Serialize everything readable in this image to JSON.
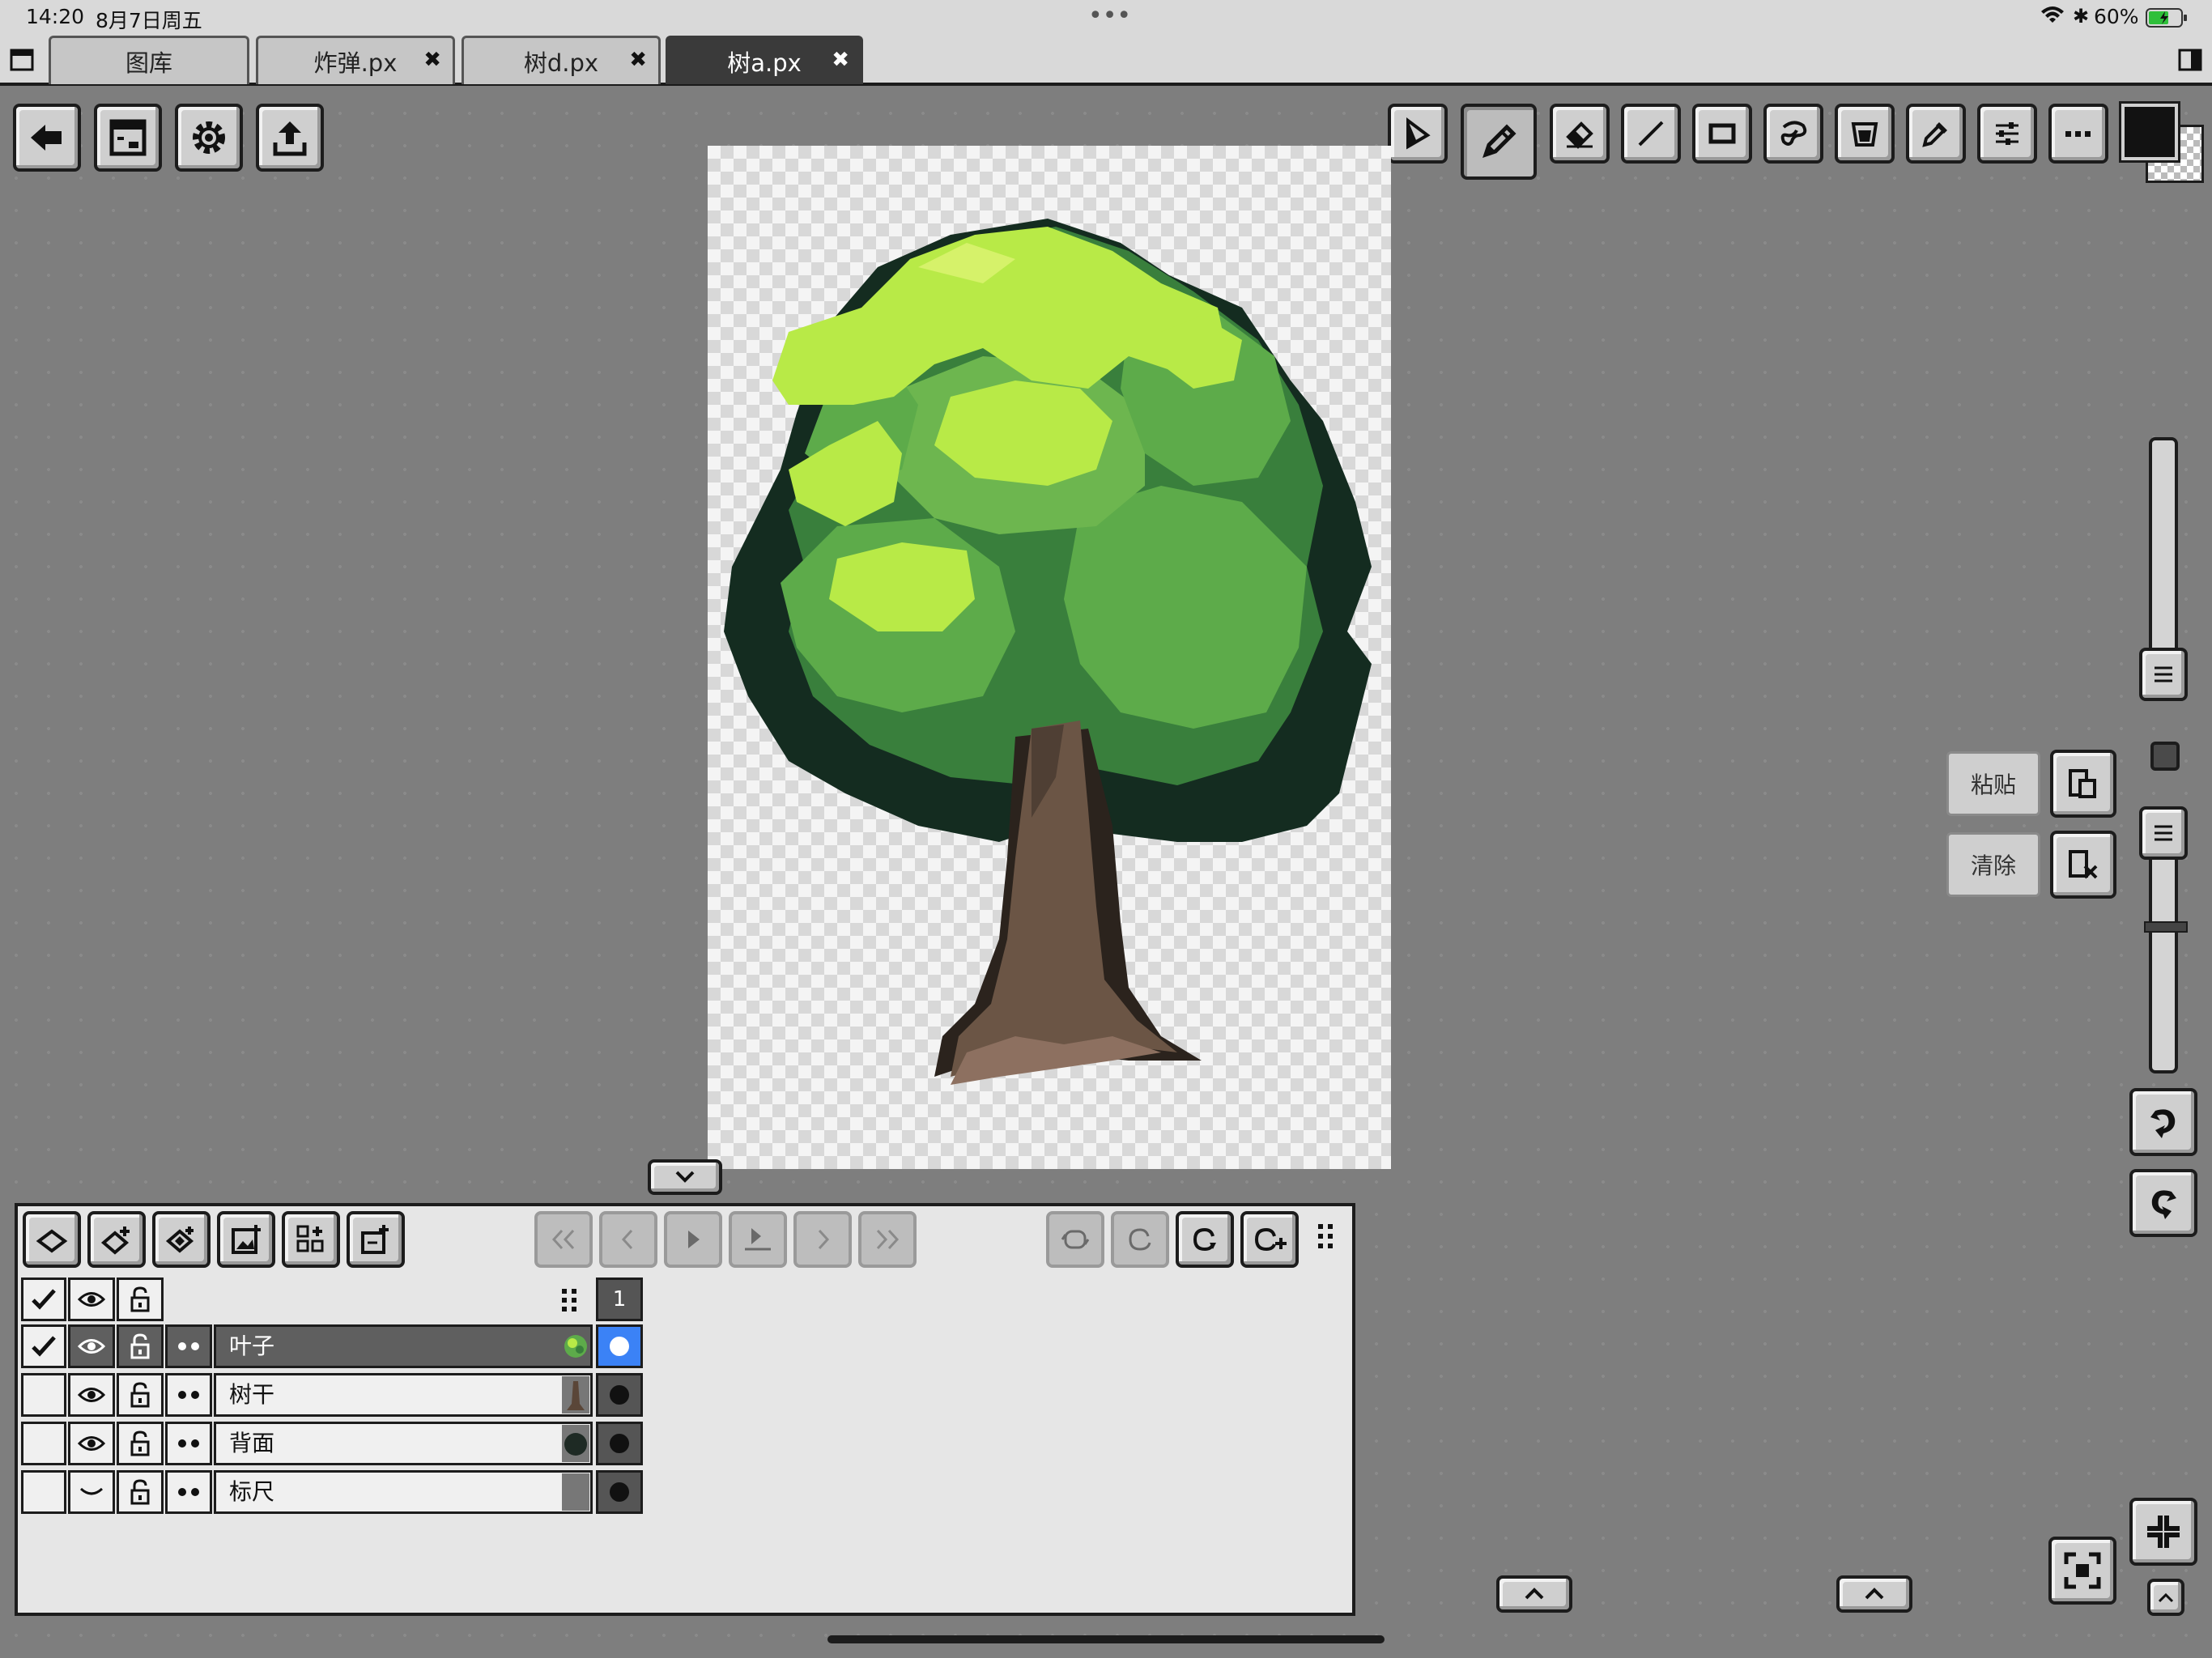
{
  "status_bar": {
    "time": "14:20",
    "date": "8月7日周五",
    "battery": "60%"
  },
  "tabs": [
    {
      "label": "图库"
    },
    {
      "label": "炸弹.px"
    },
    {
      "label": "树d.px"
    },
    {
      "label": "树a.px"
    }
  ],
  "edit_actions": {
    "paste_label": "粘贴",
    "clear_label": "清除"
  },
  "layers": {
    "frame_number": "1",
    "items": [
      {
        "name": "叶子"
      },
      {
        "name": "树干"
      },
      {
        "name": "背面"
      },
      {
        "name": "标尺"
      }
    ]
  },
  "colors": {
    "current_color": "#121212",
    "selected_dot": "#ffffff",
    "frame_highlight": "#3b82f6"
  }
}
